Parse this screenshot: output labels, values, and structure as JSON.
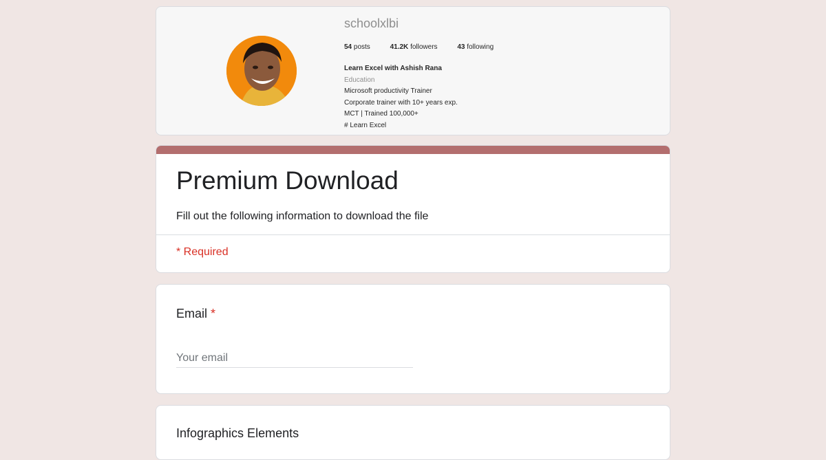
{
  "profile": {
    "username": "schoolxlbi",
    "stats": [
      {
        "count": "54",
        "label": "posts"
      },
      {
        "count": "41.2K",
        "label": "followers"
      },
      {
        "count": "43",
        "label": "following"
      }
    ],
    "bio": {
      "name": "Learn Excel with Ashish Rana",
      "category": "Education",
      "lines": [
        "Microsoft productivity Trainer",
        "Corporate trainer with 10+ years exp.",
        "MCT | Trained 100,000+",
        "# Learn Excel"
      ]
    },
    "avatar_color": "#f28a0c"
  },
  "form": {
    "title": "Premium Download",
    "description": "Fill out the following information to download the file",
    "required_note": "* Required",
    "accent_color": "#b36e6e"
  },
  "questions": {
    "email": {
      "label": "Email",
      "required_mark": "*",
      "placeholder": "Your email"
    },
    "infographics": {
      "label": "Infographics Elements"
    }
  }
}
